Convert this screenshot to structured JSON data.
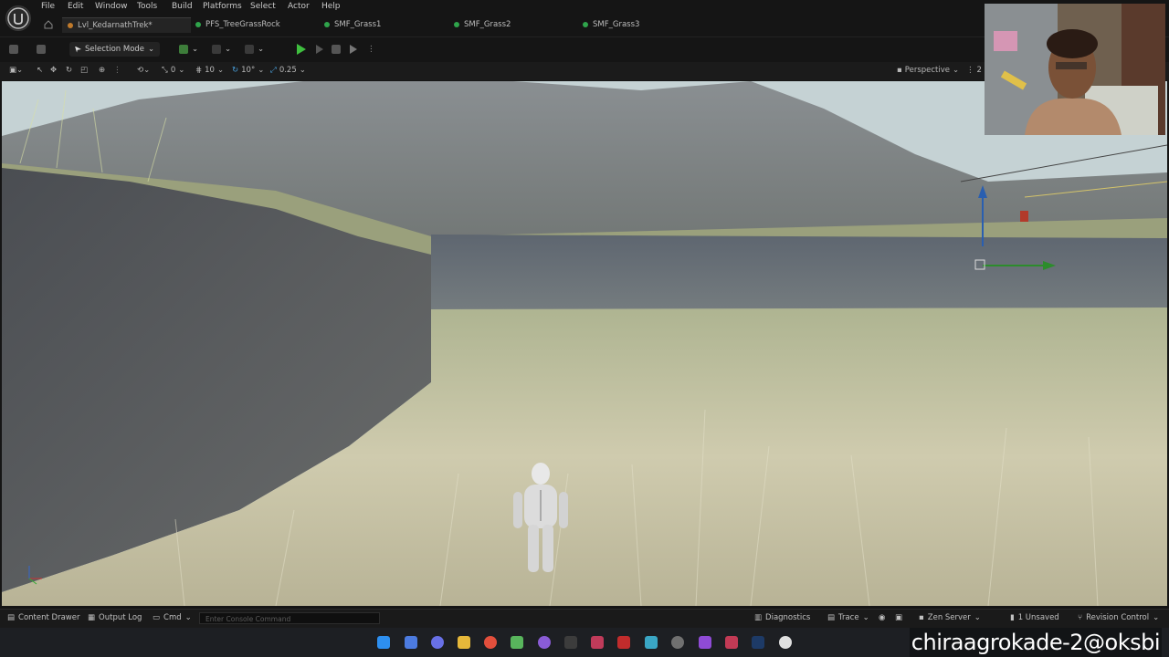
{
  "menu": [
    "File",
    "Edit",
    "Window",
    "Tools",
    "Build",
    "Platforms",
    "Select",
    "Actor",
    "Help"
  ],
  "tabs": [
    {
      "label": "Lvl_KedarnathTrek*",
      "active": true
    },
    {
      "label": "PFS_TreeGrassRock",
      "active": false
    },
    {
      "label": "SMF_Grass1",
      "active": false
    },
    {
      "label": "SMF_Grass2",
      "active": false
    },
    {
      "label": "SMF_Grass3",
      "active": false
    }
  ],
  "toolbar": {
    "selection_mode": "Selection Mode"
  },
  "viewport_toolbar": {
    "rotation_snap": "0",
    "grid_snap": "10",
    "angle_snap": "10°",
    "scale_snap": "0.25",
    "view_mode": "Perspective",
    "camera_speed": "2"
  },
  "statusbar": {
    "content_drawer": "Content Drawer",
    "output_log": "Output Log",
    "cmd": "Cmd",
    "console_placeholder": "Enter Console Command",
    "diagnostics": "Diagnostics",
    "trace": "Trace",
    "zen_server": "Zen Server",
    "unsaved": "1 Unsaved",
    "revision_control": "Revision Control"
  },
  "watermark": "chiraagrokade-2@oksbi",
  "colors": {
    "play": "#3fbf3f",
    "accent_tab": "#c07a2b",
    "asset_dot": "#2fa44b"
  }
}
